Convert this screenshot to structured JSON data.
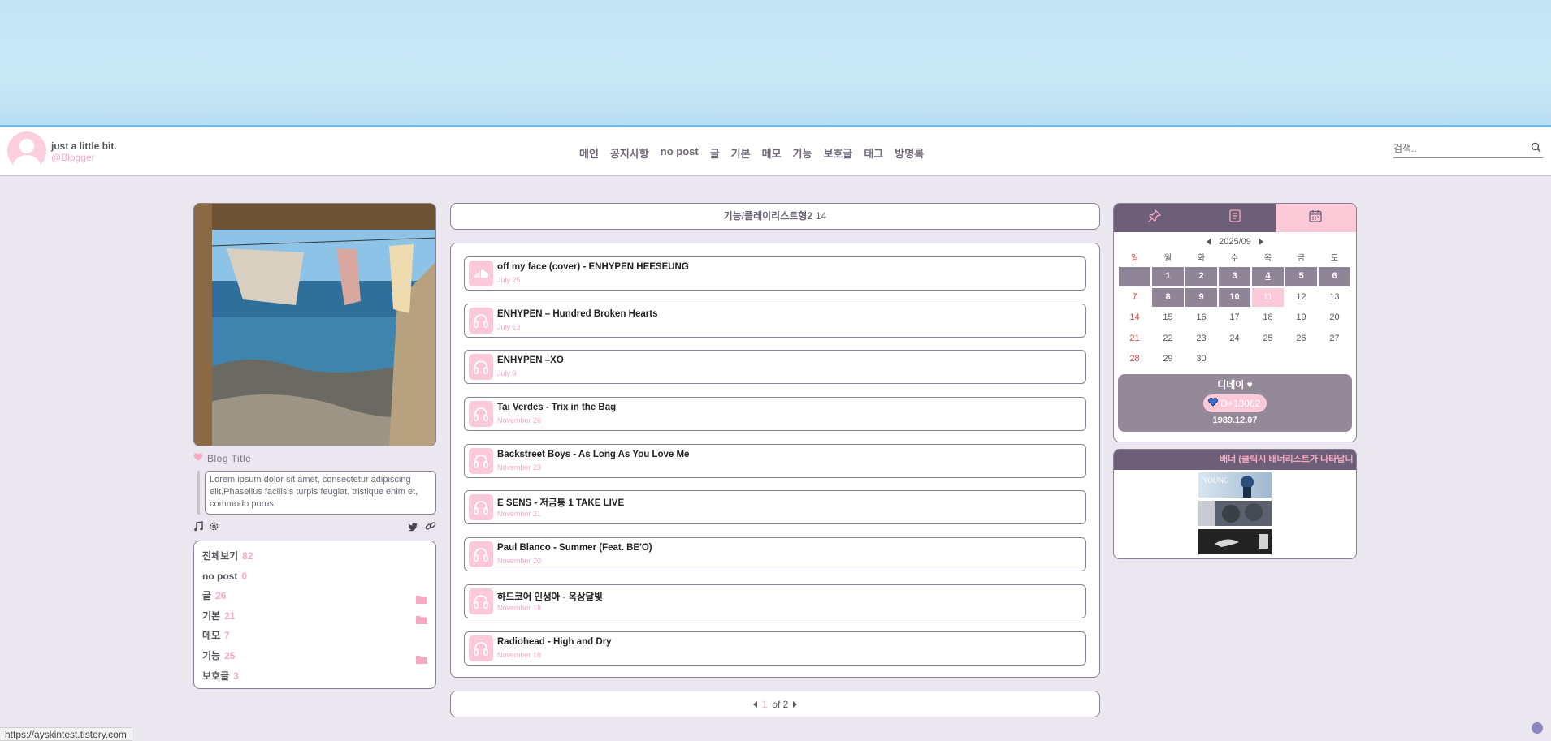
{
  "header": {
    "blog_name": "just a little bit.",
    "blog_user": "@Blogger",
    "nav": [
      "메인",
      "공지사항",
      "no post",
      "글",
      "기본",
      "메모",
      "기능",
      "보호글",
      "태그",
      "방명록"
    ],
    "search_placeholder": "검색.."
  },
  "profile": {
    "blog_title": "Blog Title",
    "description": "Lorem ipsum dolor sit amet, consectetur adipiscing elit.Phasellus facilisis turpis feugiat, tristique enim et, commodo purus."
  },
  "categories": [
    {
      "name": "전체보기",
      "count": "82"
    },
    {
      "name": "no post",
      "count": "0"
    },
    {
      "name": "글",
      "count": "26"
    },
    {
      "name": "기본",
      "count": "21"
    },
    {
      "name": "메모",
      "count": "7"
    },
    {
      "name": "기능",
      "count": "25"
    },
    {
      "name": "보호글",
      "count": "3"
    }
  ],
  "content": {
    "category_title": "기능/플레이리스트형2",
    "category_count": "14",
    "posts": [
      {
        "title": "off my face (cover) - ENHYPEN HEESEUNG",
        "date": "July 25",
        "icon": "soundcloud-icon"
      },
      {
        "title": "ENHYPEN – Hundred Broken Hearts",
        "date": "July 13",
        "icon": "headphones-icon"
      },
      {
        "title": "ENHYPEN –XO",
        "date": "July 9",
        "icon": "headphones-icon"
      },
      {
        "title": "Tai Verdes - Trix in the Bag",
        "date": "November 26",
        "icon": "headphones-icon"
      },
      {
        "title": "Backstreet Boys - As Long As You Love Me",
        "date": "November 23",
        "icon": "headphones-icon"
      },
      {
        "title": "E SENS - 저금통 1 TAKE LIVE",
        "date": "November 21",
        "icon": "headphones-icon"
      },
      {
        "title": "Paul Blanco - Summer (Feat. BE'O)",
        "date": "November 20",
        "icon": "headphones-icon"
      },
      {
        "title": "하드코어 인생아 - 옥상달빛",
        "date": "November 19",
        "icon": "headphones-icon"
      },
      {
        "title": "Radiohead - High and Dry",
        "date": "November 18",
        "icon": "headphones-icon"
      }
    ],
    "pager": {
      "current": "1",
      "of": "of 2"
    }
  },
  "calendar": {
    "month": "2025/09",
    "weekdays": [
      "일",
      "월",
      "화",
      "수",
      "목",
      "금",
      "토"
    ],
    "days": [
      "",
      "1",
      "2",
      "3",
      "4",
      "5",
      "6",
      "7",
      "8",
      "9",
      "10",
      "11",
      "12",
      "13",
      "14",
      "15",
      "16",
      "17",
      "18",
      "19",
      "20",
      "21",
      "22",
      "23",
      "24",
      "25",
      "26",
      "27",
      "28",
      "29",
      "30"
    ],
    "today": "11"
  },
  "dday": {
    "title": "디데이",
    "count": "D+13062",
    "date": "1989.12.07"
  },
  "banner": {
    "title": "배너 (클릭시 배너리스트가 나타납니"
  },
  "status_url": "https://ayskintest.tistory.com",
  "colors": {
    "accent_pink": "#f6a9c0",
    "pink_fill": "#fbc9d8",
    "purple_dark": "#6c5f77",
    "purple_mid": "#8f8597",
    "border": "#8a7f96"
  }
}
